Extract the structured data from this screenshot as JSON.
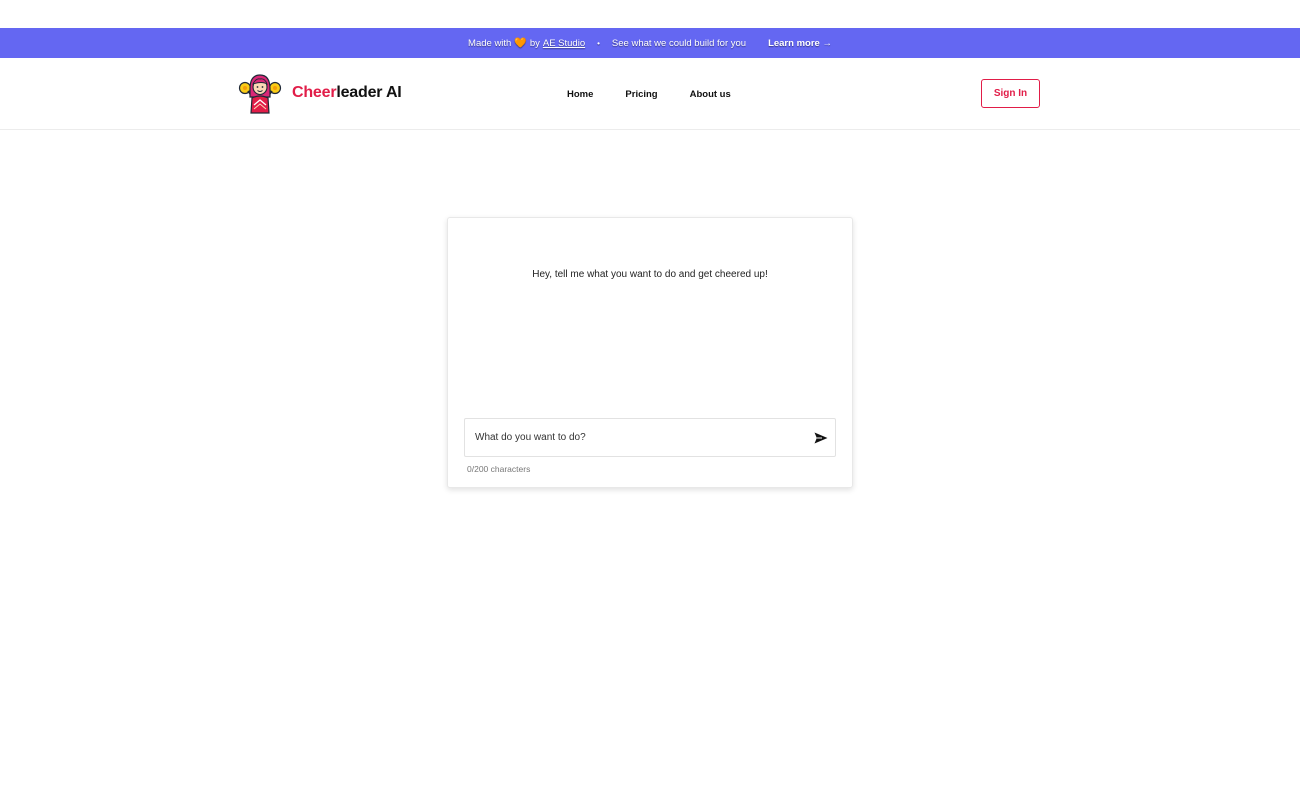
{
  "promo": {
    "made_with": "Made with",
    "heart": "🧡",
    "by": "by",
    "studio": "AE Studio",
    "separator": "•",
    "tagline": "See what we could build for you",
    "learn_more": "Learn more →"
  },
  "header": {
    "logo_icon": "cheerleader-icon",
    "logo_part1": "Cheer",
    "logo_part2": "leader AI",
    "nav": [
      {
        "label": "Home"
      },
      {
        "label": "Pricing"
      },
      {
        "label": "About us"
      }
    ],
    "sign_in": "Sign In"
  },
  "chat": {
    "greeting": "Hey, tell me what you want to do and get cheered up!",
    "input_value": "",
    "input_placeholder": "What do you want to do?",
    "send_icon": "send-icon",
    "counter": "0/200 characters"
  },
  "colors": {
    "promo_bg": "#6467f2",
    "brand": "#e11d48",
    "text": "#111111"
  }
}
